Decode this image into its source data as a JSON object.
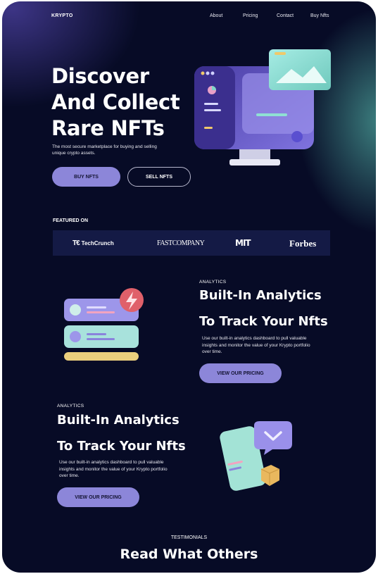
{
  "header": {
    "logo": "KRYPTO",
    "nav": [
      "About",
      "Pricing",
      "Contact",
      "Buy Nfts"
    ]
  },
  "hero": {
    "title_lines": [
      "Discover",
      "And Collect",
      "Rare NFTs"
    ],
    "subtitle": "The most secure marketplace for buying and selling unique crypto assets.",
    "buy_label": "BUY NFTS",
    "sell_label": "SELL NFTS"
  },
  "featured": {
    "label": "FEATURED ON",
    "brands": [
      "TechCrunch",
      "FASTCOMPANY",
      "MIT",
      "Forbes"
    ]
  },
  "section1": {
    "eyebrow": "ANALYTICS",
    "title_line1": "Built-In Analytics",
    "title_line2": "To Track Your Nfts",
    "text": "Use our built-in analytics dashboard to pull valuable insights and monitor the value of your Krypto portfolio over time.",
    "button": "VIEW OUR PRICING"
  },
  "section2": {
    "eyebrow": "ANALYTICS",
    "title_line1": "Built-In Analytics",
    "title_line2": "To Track Your Nfts",
    "text": "Use our built-in analytics dashboard to pull valuable insights and monitor the value of your Krypto portfolio over time.",
    "button": "VIEW OUR PRICING"
  },
  "testimonials": {
    "eyebrow": "TESTIMONIALS",
    "title": "Read What Others"
  },
  "colors": {
    "background": "#070b26",
    "accent": "#8c86d9",
    "teal_glow": "#50aaa0",
    "logo_bar": "#141a45"
  },
  "icons": [
    "monitor-illustration",
    "analytics-cards-illustration",
    "phone-chat-illustration",
    "techcrunch-logo",
    "fastcompany-logo",
    "mit-logo",
    "forbes-logo"
  ]
}
